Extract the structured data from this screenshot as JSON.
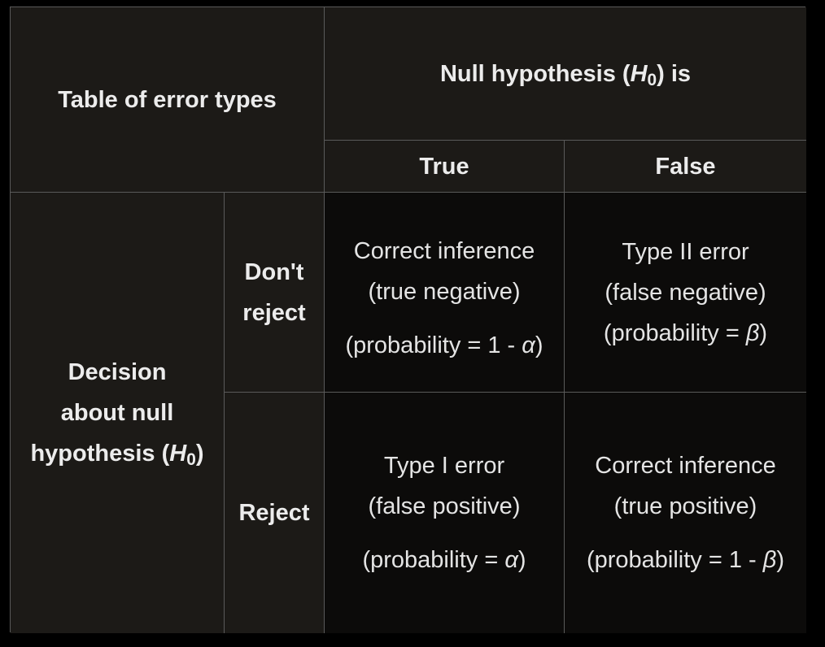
{
  "table": {
    "corner_title": "Table of error types",
    "null_header": {
      "prefix": "Null hypothesis (",
      "symbol": "H",
      "subscript": "0",
      "suffix": ") is"
    },
    "columns": [
      "True",
      "False"
    ],
    "decision_header": {
      "line1": "Decision",
      "line2": "about null",
      "line3_prefix": "hypothesis (",
      "symbol": "H",
      "subscript": "0",
      "line3_suffix": ")"
    },
    "rows": [
      "Don't reject",
      "Reject"
    ],
    "cells": {
      "dont_reject_true": {
        "title": "Correct inference",
        "subtitle": "(true negative)",
        "prob_prefix": "(probability = 1 - ",
        "prob_symbol": "α",
        "prob_suffix": ")"
      },
      "dont_reject_false": {
        "title": "Type II error",
        "subtitle": "(false negative)",
        "prob_prefix": "(probability = ",
        "prob_symbol": "β",
        "prob_suffix": ")"
      },
      "reject_true": {
        "title": "Type I error",
        "subtitle": "(false positive)",
        "prob_prefix": "(probability = ",
        "prob_symbol": "α",
        "prob_suffix": ")"
      },
      "reject_false": {
        "title": "Correct inference",
        "subtitle": "(true positive)",
        "prob_prefix": "(probability = 1 - ",
        "prob_symbol": "β",
        "prob_suffix": ")"
      }
    }
  },
  "colors": {
    "background": "#000000",
    "header_fill": "#1c1a17",
    "body_fill": "#0c0b0a",
    "border": "#5a5a5a",
    "text": "#e8e8e8"
  }
}
